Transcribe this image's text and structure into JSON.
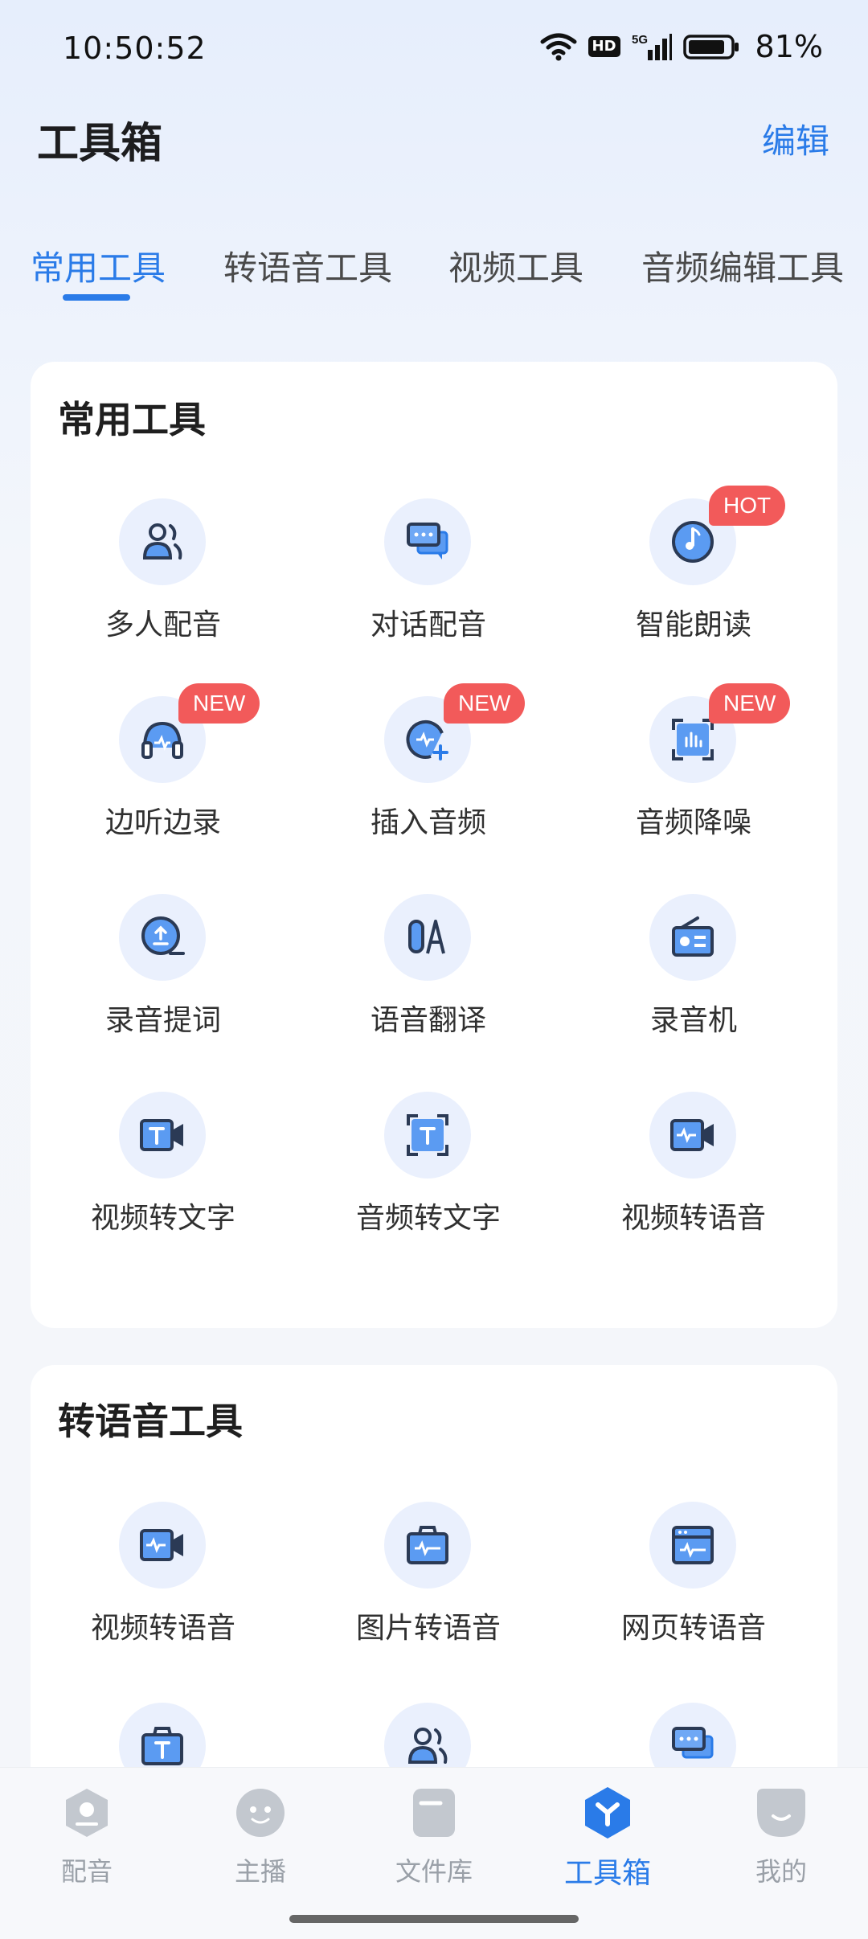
{
  "status_bar": {
    "time": "10:50:52",
    "hd": "HD",
    "network": "5G",
    "battery": "81%"
  },
  "header": {
    "title": "工具箱",
    "edit": "编辑"
  },
  "tabs": [
    {
      "label": "常用工具",
      "active": true
    },
    {
      "label": "转语音工具",
      "active": false
    },
    {
      "label": "视频工具",
      "active": false
    },
    {
      "label": "音频编辑工具",
      "active": false
    }
  ],
  "common_tools": {
    "title": "常用工具",
    "items": [
      {
        "label": "多人配音",
        "icon": "multi-person-icon",
        "badge": ""
      },
      {
        "label": "对话配音",
        "icon": "chat-bubbles-icon",
        "badge": ""
      },
      {
        "label": "智能朗读",
        "icon": "music-disc-icon",
        "badge": "HOT"
      },
      {
        "label": "边听边录",
        "icon": "headphones-icon",
        "badge": "NEW"
      },
      {
        "label": "插入音频",
        "icon": "insert-audio-icon",
        "badge": "NEW"
      },
      {
        "label": "音频降噪",
        "icon": "noise-reduction-icon",
        "badge": "NEW"
      },
      {
        "label": "录音提词",
        "icon": "prompter-icon",
        "badge": ""
      },
      {
        "label": "语音翻译",
        "icon": "translate-icon",
        "badge": ""
      },
      {
        "label": "录音机",
        "icon": "radio-icon",
        "badge": ""
      },
      {
        "label": "视频转文字",
        "icon": "video-text-icon",
        "badge": ""
      },
      {
        "label": "音频转文字",
        "icon": "audio-text-icon",
        "badge": ""
      },
      {
        "label": "视频转语音",
        "icon": "video-voice-icon",
        "badge": ""
      }
    ]
  },
  "voice_tools": {
    "title": "转语音工具",
    "items": [
      {
        "label": "视频转语音",
        "icon": "video-voice-icon"
      },
      {
        "label": "图片转语音",
        "icon": "image-voice-icon"
      },
      {
        "label": "网页转语音",
        "icon": "webpage-voice-icon"
      },
      {
        "label": "",
        "icon": "text-bag-icon"
      },
      {
        "label": "",
        "icon": "multi-person-icon"
      },
      {
        "label": "",
        "icon": "chat-bubbles-icon"
      }
    ]
  },
  "bottom_nav": [
    {
      "label": "配音",
      "icon": "dubbing-icon",
      "active": false
    },
    {
      "label": "主播",
      "icon": "anchor-face-icon",
      "active": false
    },
    {
      "label": "文件库",
      "icon": "file-library-icon",
      "active": false
    },
    {
      "label": "工具箱",
      "icon": "toolbox-icon",
      "active": true
    },
    {
      "label": "我的",
      "icon": "profile-icon",
      "active": false
    }
  ],
  "colors": {
    "accent": "#2a7be8",
    "badge": "#f25a5a",
    "icon_dark": "#2b3a55",
    "icon_light": "#5b9bf2"
  }
}
